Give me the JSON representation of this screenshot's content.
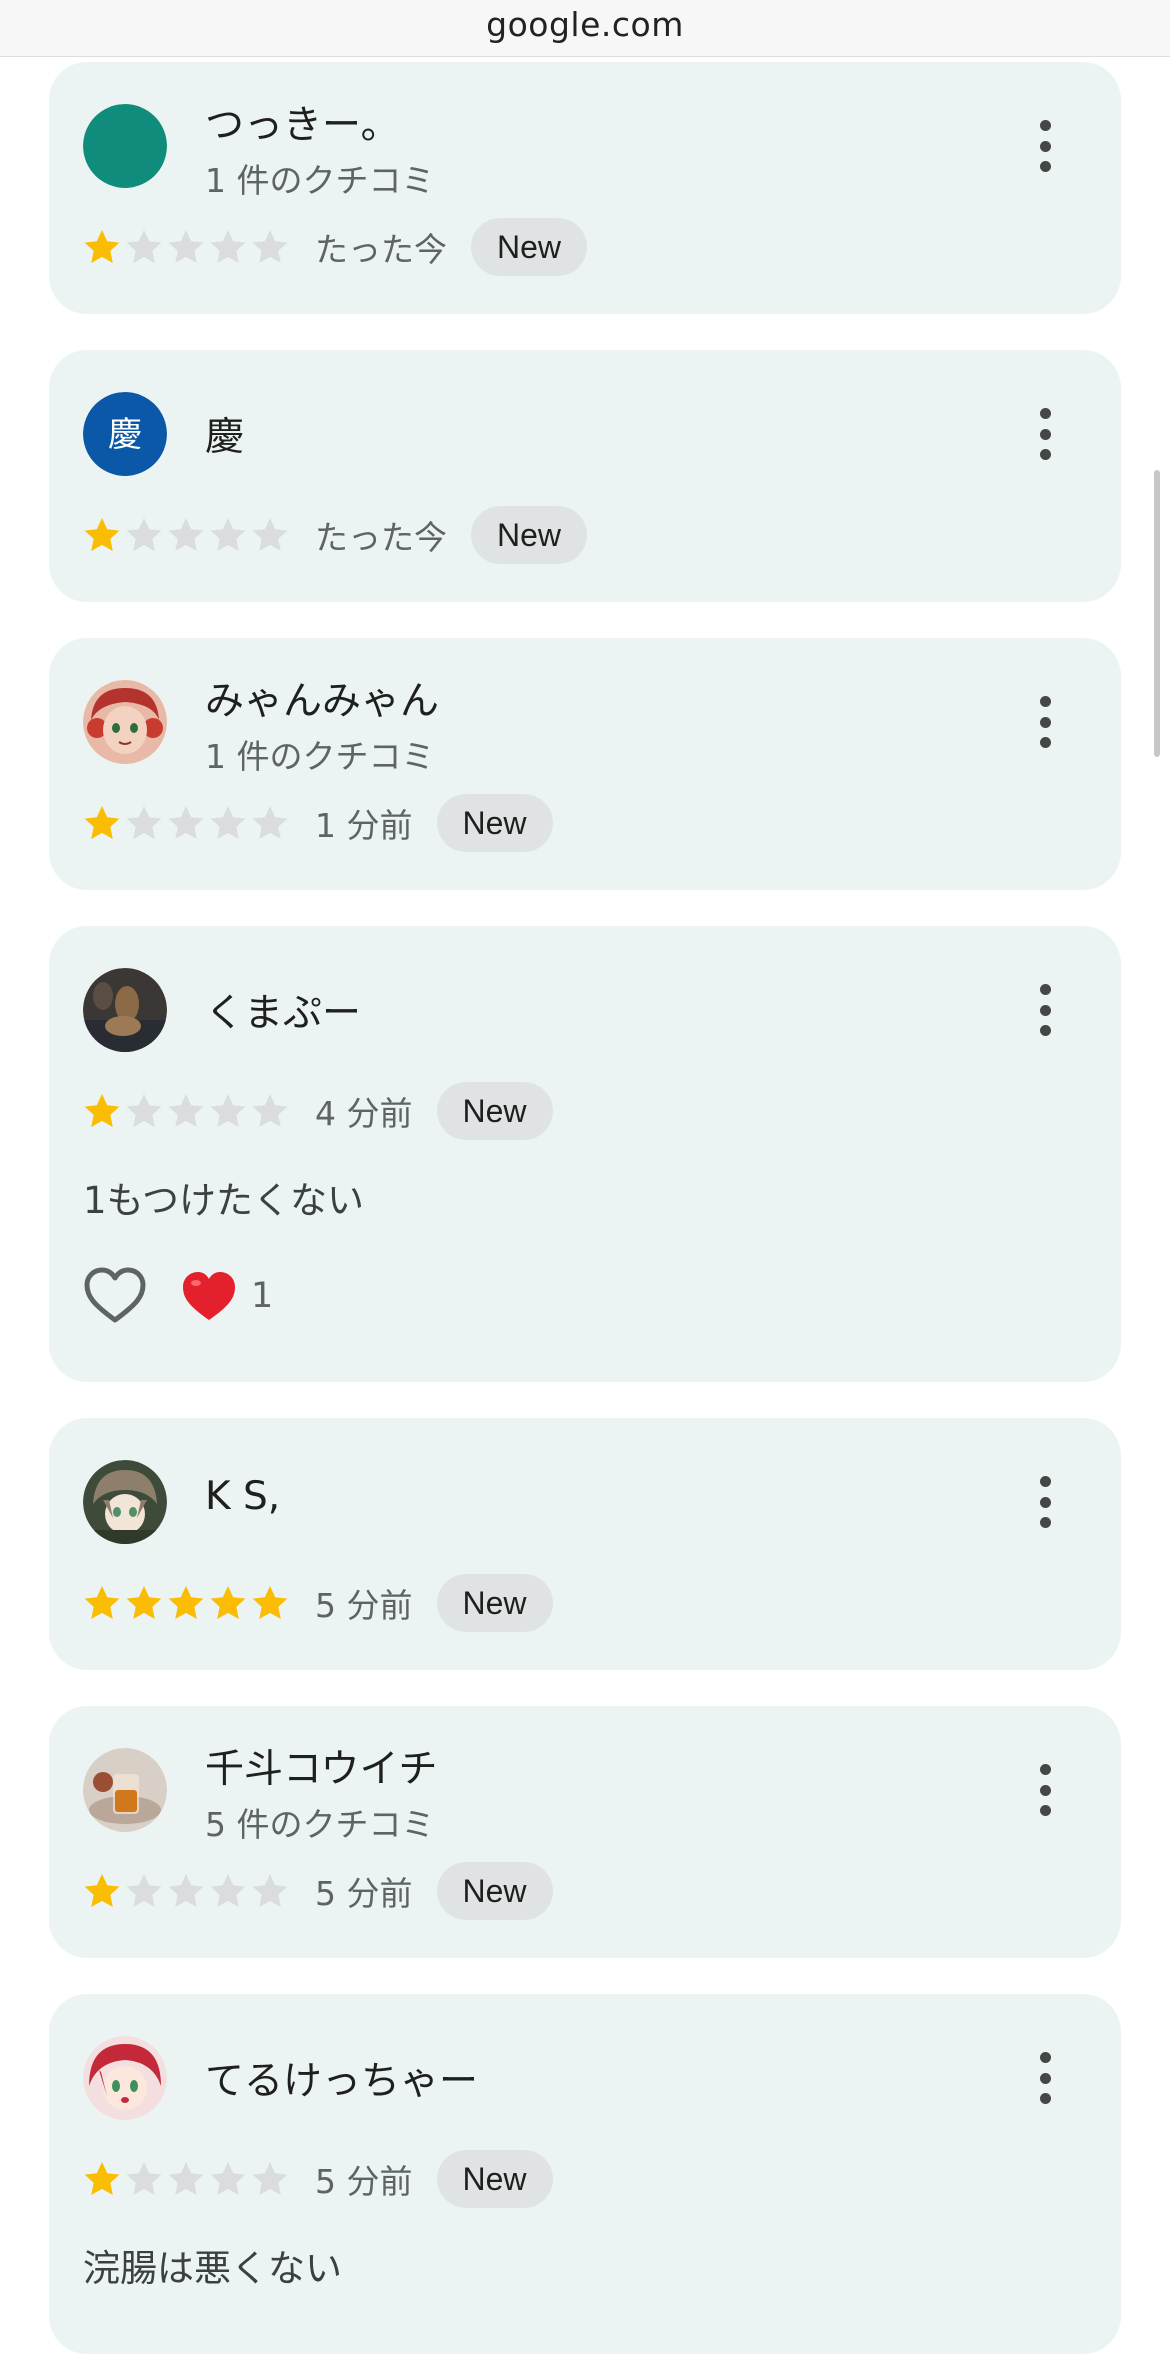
{
  "browser": {
    "url": "google.com"
  },
  "colors": {
    "card_bg": "#ecf3f3",
    "star_filled": "#fbbc04",
    "star_empty": "#dadce0",
    "badge_bg": "#dfe3e3",
    "heart_red": "#e3202b"
  },
  "reviews": [
    {
      "name": "つっきー。",
      "subtitle": "1 件のクチコミ",
      "stars": 1,
      "time": "たった今",
      "badge": "New",
      "avatar": "teal-circle"
    },
    {
      "name": "慶",
      "avatar_letter": "慶",
      "stars": 1,
      "time": "たった今",
      "badge": "New",
      "avatar": "blue-letter"
    },
    {
      "name": "みゃんみゃん",
      "subtitle": "1 件のクチコミ",
      "stars": 1,
      "time": "1 分前",
      "badge": "New",
      "avatar": "anime-girl-photo"
    },
    {
      "name": "くまぷー",
      "stars": 1,
      "time": "4 分前",
      "badge": "New",
      "text": "1もつけたくない",
      "reaction_count": "1",
      "avatar": "dog-photo"
    },
    {
      "name": "K S,",
      "stars": 5,
      "time": "5 分前",
      "badge": "New",
      "avatar": "anime-boy-photo"
    },
    {
      "name": "千斗コウイチ",
      "subtitle": "5 件のクチコミ",
      "stars": 1,
      "time": "5 分前",
      "badge": "New",
      "avatar": "drink-photo"
    },
    {
      "name": "てるけっちゃー",
      "stars": 1,
      "time": "5 分前",
      "badge": "New",
      "text": "浣腸は悪くない",
      "avatar": "redhead-anime-photo"
    }
  ],
  "icons": {
    "menu": "more-vert-icon",
    "like": "heart-outline-icon",
    "reaction": "red-heart-emoji",
    "star": "star-icon"
  }
}
